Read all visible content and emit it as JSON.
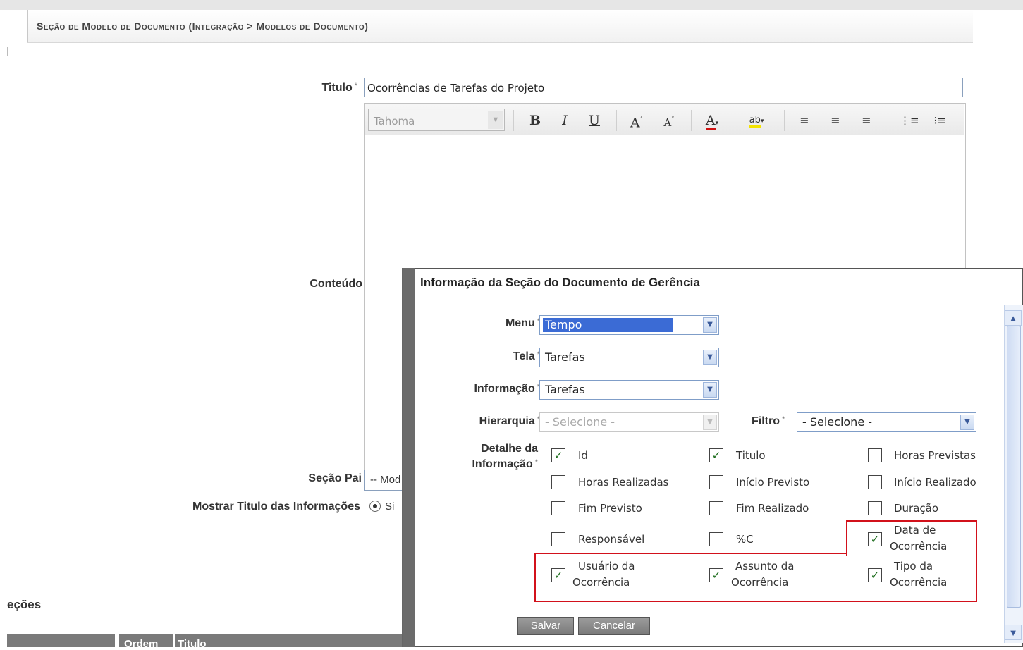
{
  "breadcrumb": "Seção de Modelo de Documento  (Integração > Modelos de Documento)",
  "form": {
    "title_label": "Titulo",
    "title_value": "Ocorrências de Tarefas do Projeto",
    "required_mark": "*",
    "content_label": "Conteúdo",
    "font_name": "Tahoma",
    "parent_label": "Seção Pai",
    "parent_value": "-- Mod",
    "show_title_label": "Mostrar Titulo das Informações",
    "radio_yes": "Si"
  },
  "toolbar": {
    "bold": "B",
    "italic": "I",
    "underline": "U",
    "grow": "A",
    "shrink": "A",
    "font_color": "A",
    "highlight": "ab"
  },
  "bottom": {
    "sections_heading": "eções",
    "col_ordem": "Ordem",
    "col_titulo": "Titulo"
  },
  "dialog": {
    "title": "Informação da Seção do Documento de Gerência",
    "menu_label": "Menu",
    "menu_value": "Tempo",
    "tela_label": "Tela",
    "tela_value": "Tarefas",
    "info_label": "Informação",
    "info_value": "Tarefas",
    "hier_label": "Hierarquia",
    "hier_value": "- Selecione -",
    "filtro_label": "Filtro",
    "filtro_value": "- Selecione -",
    "detail_label_1": "Detalhe da",
    "detail_label_2": "Informação",
    "checkboxes": [
      {
        "label": "Id",
        "checked": true
      },
      {
        "label": "Titulo",
        "checked": true
      },
      {
        "label": "Horas Previstas",
        "checked": false
      },
      {
        "label": "Horas Realizadas",
        "checked": false
      },
      {
        "label": "Início Previsto",
        "checked": false
      },
      {
        "label": "Início Realizado",
        "checked": false
      },
      {
        "label": "Fim Previsto",
        "checked": false
      },
      {
        "label": "Fim Realizado",
        "checked": false
      },
      {
        "label": "Duração",
        "checked": false
      },
      {
        "label": "Responsável",
        "checked": false
      },
      {
        "label": "%C",
        "checked": false
      },
      {
        "label_1": "Data de",
        "label_2": "Ocorrência",
        "checked": true
      },
      {
        "label_1": "Usuário da",
        "label_2": "Ocorrência",
        "checked": true
      },
      {
        "label_1": "Assunto da",
        "label_2": "Ocorrência",
        "checked": true
      },
      {
        "label_1": "Tipo da",
        "label_2": "Ocorrência",
        "checked": true
      }
    ],
    "save_label": "Salvar",
    "cancel_label": "Cancelar",
    "check_glyph": "✓",
    "highlight_color": "#d2111b"
  }
}
